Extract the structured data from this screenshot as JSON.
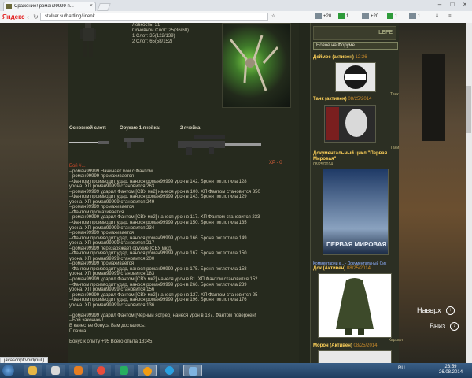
{
  "browser": {
    "brand": "Яндекс",
    "tab_title": "Сражение! роман99999 п...",
    "address": "stalker.su/battling/linenk",
    "toolbar": {
      "v1": "+20",
      "v2": "1",
      "v3": "+20",
      "v4": "1",
      "v5": "1"
    }
  },
  "character": {
    "stats": [
      "Ловкость: 31",
      "Основной Слот: 25(36/60)",
      "1 Слот: 35(122/139)",
      "2 Слот: 65(58/152)"
    ]
  },
  "slots": {
    "main": "Основной слот:",
    "w1": "Оружие 1 ячейка:",
    "w2": "2 ячейка:"
  },
  "xp": "XP - 0",
  "fight": {
    "header": "Бой #...",
    "lines": [
      "--роман99999 Начинает бой с Фантом!",
      "--роман99999 промахивается",
      "--Фантом производит удар, нанося роман99999 урон в 142. Броня поглотила 128",
      "урона. ХП роман99999 становится 263",
      "--роман99999 ударил Фантом [СВУ мк2] нанеся урон в 100. ХП Фантом становится 350",
      "--Фантом производит удар, нанося роман99999 урон в 143. Броня поглотила 129",
      "урона. ХП роман99999 становится 249",
      "--роман99999 промахивается",
      "--Фантом промахивается",
      "--роман99999 ударил Фантом [СВУ мк2] нанеся урон в 117. ХП Фантом становится 233",
      "--Фантом производит удар, нанося роман99999 урон в 150. Броня поглотила 135",
      "урона. ХП роман99999 становится 234",
      "--роман99999 промахивается",
      "--Фантом производит удар, нанося роман99999 урон в 166. Броня поглотила 149",
      "урона. ХП роман99999 становится 217",
      "--роман99999 перезаряжает оружие [СВУ мк2].",
      "--Фантом производит удар, нанося роман99999 урон в 167. Броня поглотила 150",
      "урона. ХП роман99999 становится 200",
      "--роман99999 промахивается",
      "--Фантом производит удар, нанося роман99999 урон в 175. Броня поглотила 158",
      "урона. ХП роман99999 становится 183",
      "--роман99999 ударил Фантом [СВУ мк2] нанеся урон в 81. ХП Фантом становится 152",
      "--Фантом производит удар, нанося роман99999 урон в 266. Броня поглотила 239",
      "урона. ХП роман99999 становится 156",
      "--роман99999 ударил Фантом [СВУ мк2] нанеся урон в 127. ХП Фантом становится 25",
      "--Фантом производит удар, нанося роман99999 урон в 196. Броня поглотила 176",
      "урона. ХП роман99999 становится 136",
      "",
      "--роман99999 ударил Фантом [Чёрный ястреб] нанеся урон в 137. Фантом повержен!",
      "--Бой закончен!",
      "В качестве бонуса Вам досталось:",
      "Плазма",
      "",
      "Бонус к опыту +95 Всего опыта 18345."
    ]
  },
  "sidebar": {
    "title": "Новое на Форуме",
    "nick_label": "LEFE",
    "posts": [
      {
        "user": "Деймос (активен)",
        "time": "12:26"
      },
      {
        "user": "Танк (активен)",
        "time": "08/25/2014"
      },
      {
        "user": "Документальный цикл \"Первая Мировая\"",
        "time": "08/25/2014"
      },
      {
        "user": "Док (Активен)",
        "time": "08/25/2014"
      },
      {
        "user": "Морон (Активен)",
        "time": "08/25/2014"
      }
    ],
    "poster_text": "ПЕРВАЯ МИРОВАЯ",
    "comment_link": "Комментарии к... - Документальный Сик",
    "small": [
      "Танк",
      "Тани",
      "Кархарт"
    ]
  },
  "page_nav": {
    "up": "Наверх",
    "down": "Вниз"
  },
  "status_bar": "javascript:void(null)",
  "taskbar": {
    "lang": "RU",
    "time": "23:59",
    "date": "26.08.2014"
  }
}
